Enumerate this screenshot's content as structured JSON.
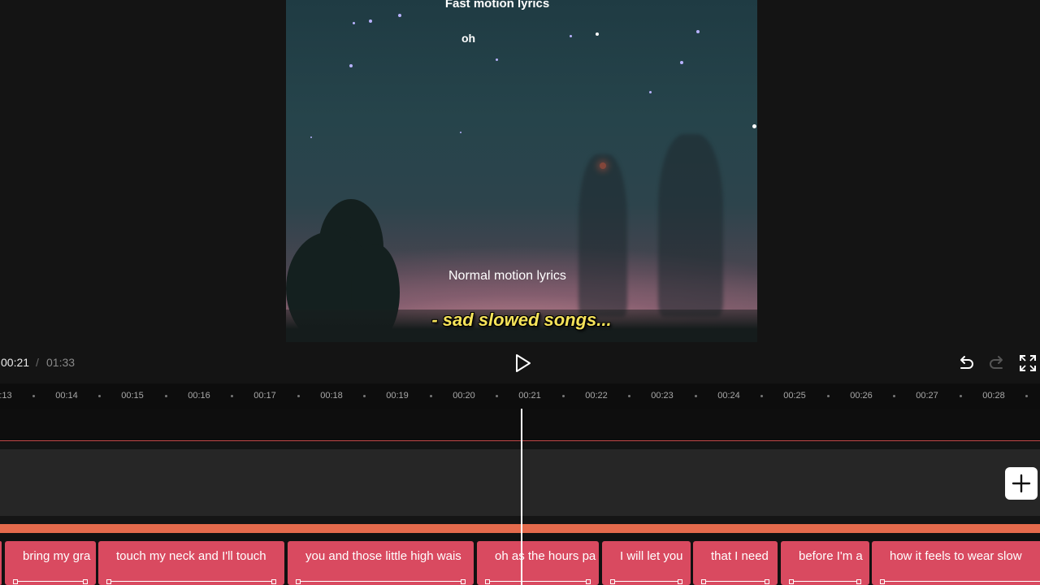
{
  "preview": {
    "caption_fast": "Fast motion lyrics",
    "caption_oh": "oh",
    "caption_normal": "Normal motion lyrics",
    "watermark": "- sad slowed songs..."
  },
  "playback": {
    "current": "00:21",
    "separator": "/",
    "total": "01:33",
    "play_icon": "play-icon",
    "undo_icon": "undo-icon",
    "redo_icon": "redo-icon",
    "fullscreen_icon": "fullscreen-icon"
  },
  "ruler": {
    "labels": [
      ":13",
      "00:14",
      "00:15",
      "00:16",
      "00:17",
      "00:18",
      "00:19",
      "00:20",
      "00:21",
      "00:22",
      "00:23",
      "00:24",
      "00:25",
      "00:26",
      "00:27",
      "00:28"
    ]
  },
  "lyrics": {
    "clips": [
      {
        "text": "bring my gra"
      },
      {
        "text": "touch my neck and I'll touch"
      },
      {
        "text": "you and those little high wais"
      },
      {
        "text": "oh as the hours pa"
      },
      {
        "text": "I will let you"
      },
      {
        "text": "that I need"
      },
      {
        "text": "before I'm a"
      },
      {
        "text": "how it feels to wear slow"
      }
    ]
  },
  "colors": {
    "lyric_clip": "#d94a60",
    "audio_line": "#e46a4c",
    "accent_red": "#c84a4a",
    "watermark": "#f6e35a"
  }
}
